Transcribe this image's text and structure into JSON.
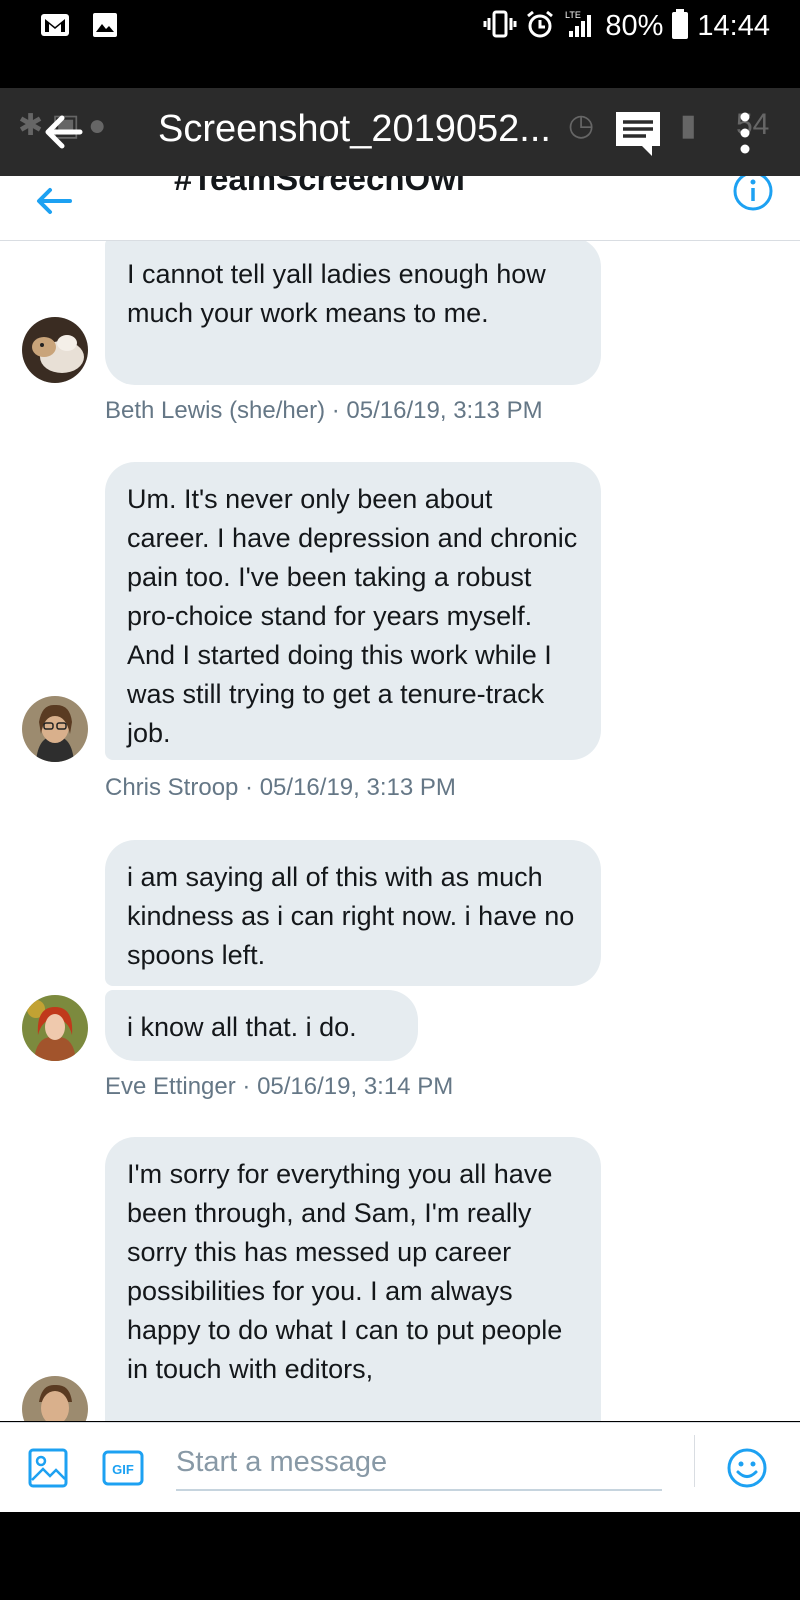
{
  "status_bar": {
    "battery": "80%",
    "time": "14:44",
    "network": "LTE"
  },
  "viewer": {
    "title": "Screenshot_2019052...",
    "ghost_time": "54"
  },
  "conversation": {
    "title": "#TeamScreechOwl"
  },
  "messages": [
    {
      "text": "I cannot tell yall ladies enough how much your work means to me.",
      "meta": "Beth Lewis (she/her) · 05/16/19, 3:13 PM"
    },
    {
      "text": "Um. It's never only been about career. I have depression and chronic pain too. I've been taking a robust pro-choice stand for years myself. And I started doing this work while I was still trying to get a tenure-track job.",
      "meta": "Chris Stroop · 05/16/19, 3:13 PM"
    },
    {
      "text": "i am saying all of this with as much kindness as i can right now. i have no spoons left.",
      "text2": "i know all that.  i do.",
      "meta": "Eve Ettinger · 05/16/19, 3:14 PM"
    },
    {
      "text": "I'm sorry for everything you all have been through, and Sam, I'm really sorry this has messed up career possibilities for you. I am always happy to do what I can to put people in touch with editors,"
    }
  ],
  "compose": {
    "placeholder": "Start a message",
    "gif_label": "GIF"
  },
  "colors": {
    "accent": "#1da1f2",
    "bubble": "#e6ecf0",
    "meta_text": "#657786",
    "viewer_bar": "#2b2b2b"
  }
}
